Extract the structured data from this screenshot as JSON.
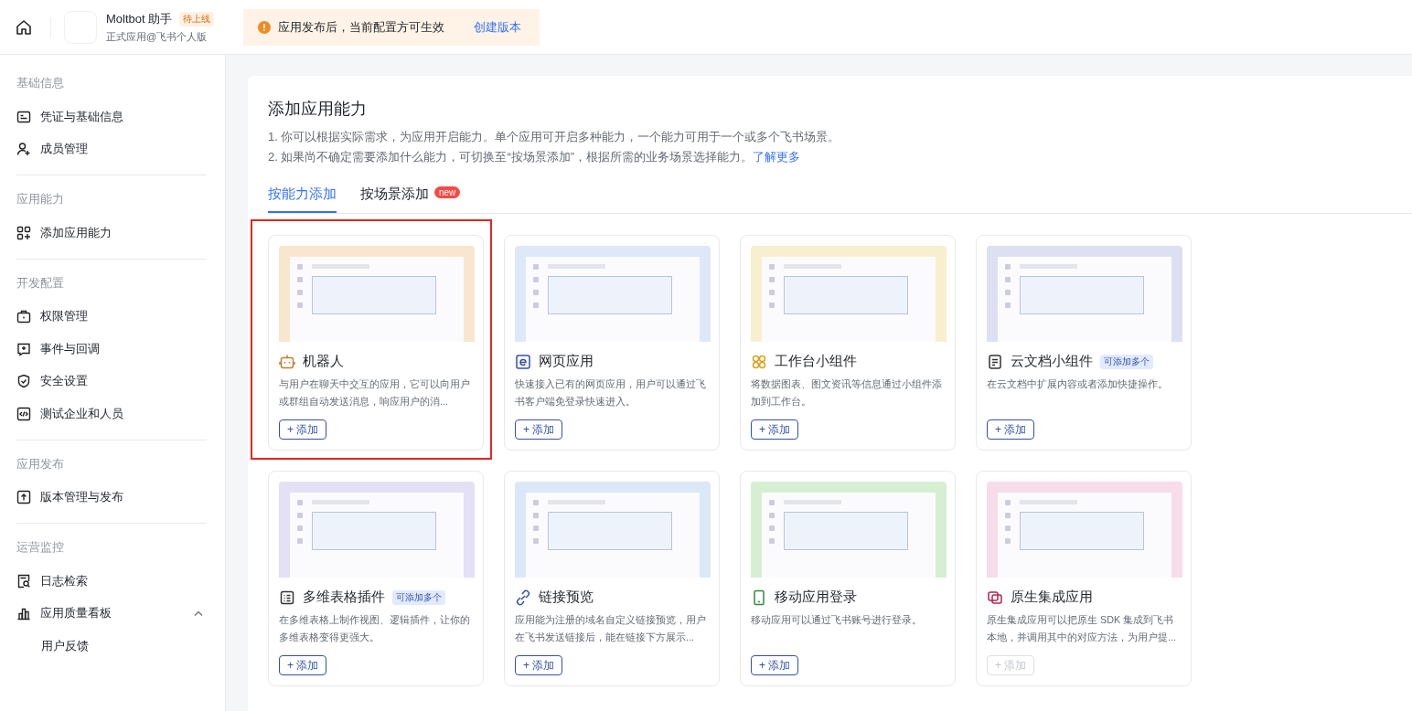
{
  "header": {
    "app_name": "Moltbot 助手",
    "status_tag": "待上线",
    "app_subtitle": "正式应用@飞书个人版",
    "notice": {
      "text": "应用发布后，当前配置方可生效",
      "link": "创建版本"
    }
  },
  "sidebar": {
    "groups": [
      {
        "title": "基础信息",
        "items": [
          {
            "label": "凭证与基础信息",
            "kind": "card"
          },
          {
            "label": "成员管理",
            "kind": "user-add"
          }
        ]
      },
      {
        "title": "应用能力",
        "items": [
          {
            "label": "添加应用能力",
            "kind": "grid-add"
          }
        ]
      },
      {
        "title": "开发配置",
        "items": [
          {
            "label": "权限管理",
            "kind": "briefcase"
          },
          {
            "label": "事件与回调",
            "kind": "event"
          },
          {
            "label": "安全设置",
            "kind": "shield"
          },
          {
            "label": "测试企业和人员",
            "kind": "code"
          }
        ]
      },
      {
        "title": "应用发布",
        "items": [
          {
            "label": "版本管理与发布",
            "kind": "upload"
          }
        ]
      },
      {
        "title": "运营监控",
        "items": [
          {
            "label": "日志检索",
            "kind": "log-search"
          },
          {
            "label": "应用质量看板",
            "kind": "bar-chart",
            "expanded": true,
            "children": [
              {
                "label": "用户反馈"
              }
            ]
          }
        ]
      }
    ]
  },
  "page": {
    "title": "添加应用能力",
    "notes": [
      "1. 你可以根据实际需求，为应用开启能力。单个应用可开启多种能力，一个能力可用于一个或多个飞书场景。",
      "2. 如果尚不确定需要添加什么能力，可切换至“按场景添加”，根据所需的业务场景选择能力。"
    ],
    "notes_link": "了解更多",
    "tabs": [
      {
        "label": "按能力添加",
        "selected": true
      },
      {
        "label": "按场景添加",
        "selected": false,
        "badge": "new"
      }
    ],
    "cards": [
      {
        "title": "机器人",
        "kind": "robot",
        "color": "#f9e6cf",
        "highlighted": true,
        "description": "与用户在聊天中交互的应用，它可以向用户或群组自动发送消息，响应用户的消...",
        "button": "+ 添加",
        "disabled": false
      },
      {
        "title": "网页应用",
        "kind": "web",
        "color": "#dde8f8",
        "highlighted": false,
        "description": "快速接入已有的网页应用，用户可以通过飞书客户端免登录快速进入。",
        "button": "+ 添加",
        "disabled": false
      },
      {
        "title": "工作台小组件",
        "kind": "widget",
        "color": "#f7efcd",
        "highlighted": false,
        "description": "将数据图表、图文资讯等信息通过小组件添加到工作台。",
        "button": "+ 添加",
        "disabled": false
      },
      {
        "title": "云文档小组件",
        "kind": "doc",
        "color": "#dde0f3",
        "highlighted": false,
        "badge": "可添加多个",
        "description": "在云文档中扩展内容或者添加快捷操作。",
        "button": "+ 添加",
        "disabled": false
      },
      {
        "title": "多维表格插件",
        "kind": "table",
        "color": "#e4e0f5",
        "highlighted": false,
        "badge": "可添加多个",
        "description": "在多维表格上制作视图、逻辑插件，让你的多维表格变得更强大。",
        "button": "+ 添加",
        "disabled": false
      },
      {
        "title": "链接预览",
        "kind": "link",
        "color": "#dbe8f8",
        "highlighted": false,
        "description": "应用能为注册的域名自定义链接预览，用户在飞书发送链接后，能在链接下方展示...",
        "button": "+ 添加",
        "disabled": false
      },
      {
        "title": "移动应用登录",
        "kind": "mobile",
        "color": "#d6efd3",
        "highlighted": false,
        "description": "移动应用可以通过飞书账号进行登录。",
        "button": "+ 添加",
        "disabled": false
      },
      {
        "title": "原生集成应用",
        "kind": "native",
        "color": "#f7dcea",
        "highlighted": false,
        "description": "原生集成应用可以把原生 SDK 集成到飞书本地，并调用其中的对应方法，为用户提...",
        "button": "+ 添加",
        "disabled": true
      }
    ]
  }
}
